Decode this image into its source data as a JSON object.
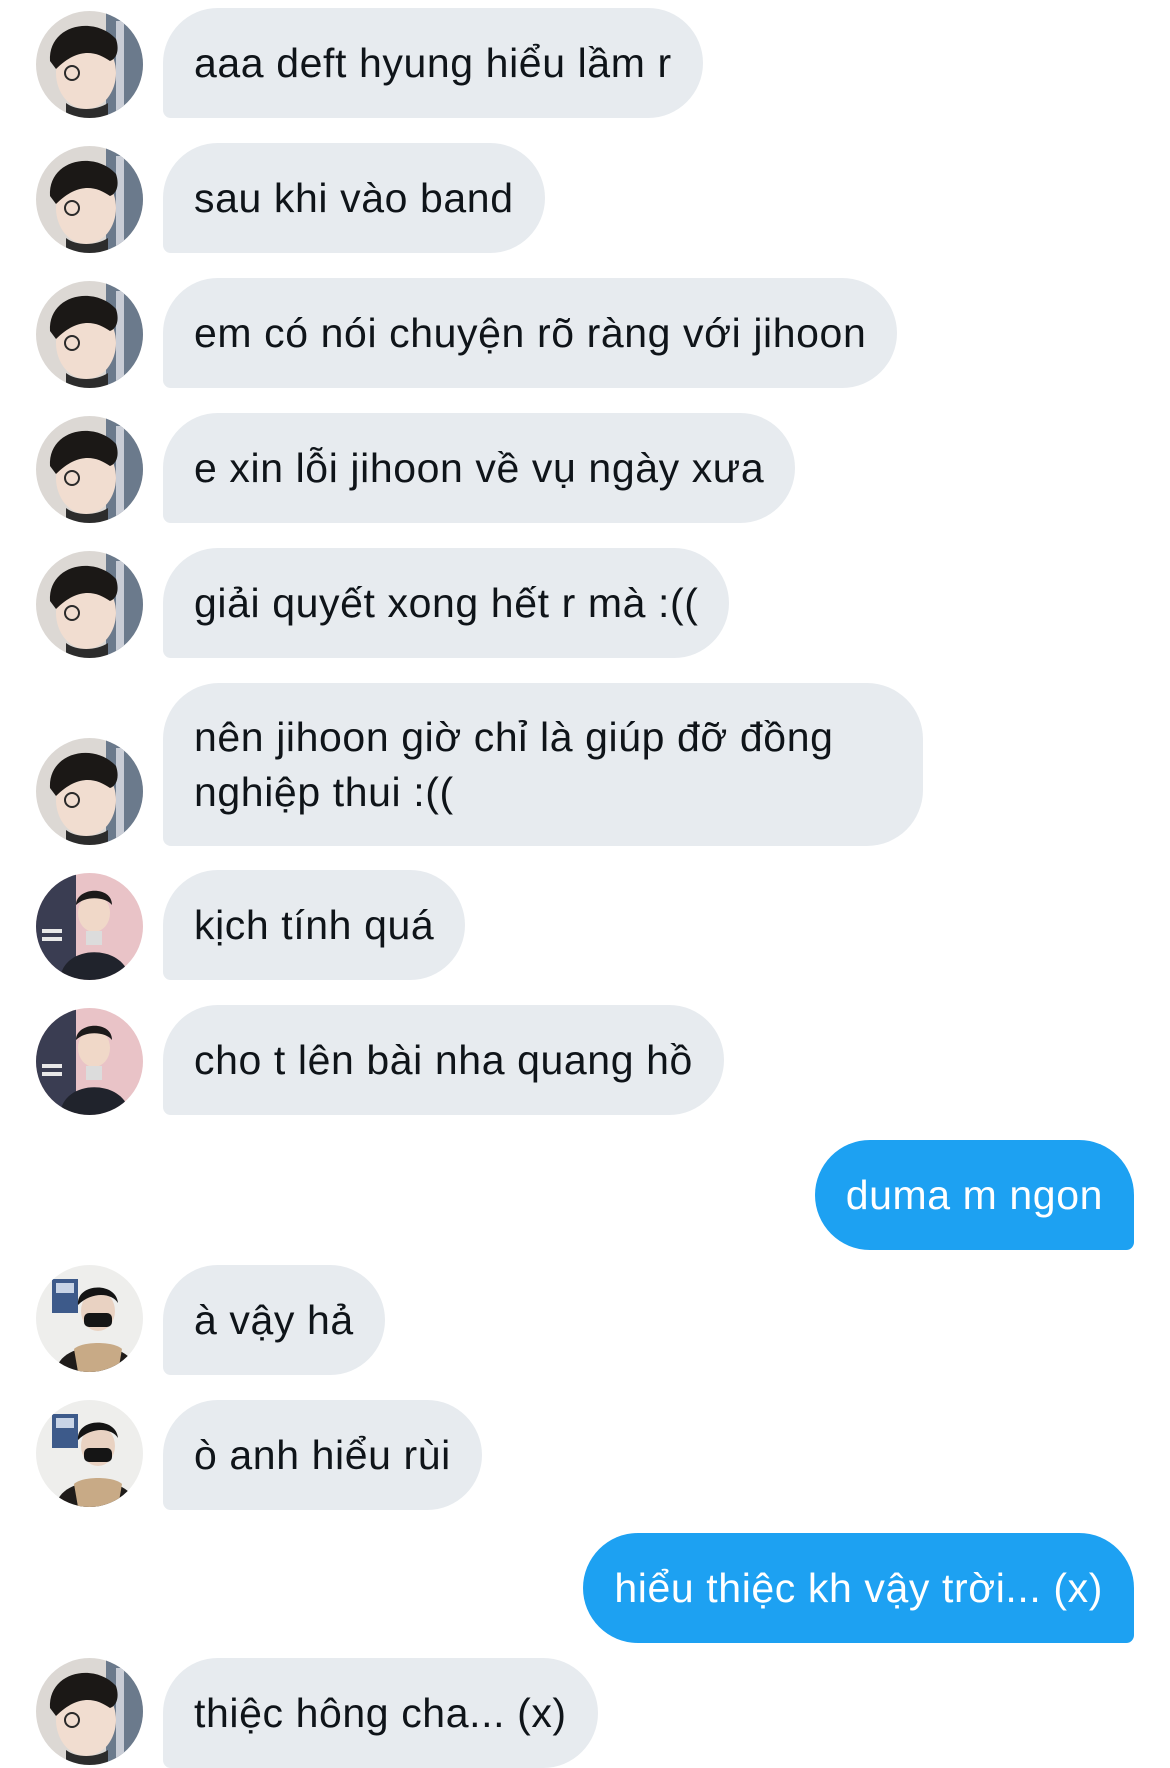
{
  "conversation": {
    "messages": [
      {
        "sender": "contact_a",
        "text": "aaa deft hyung hiểu lầm r"
      },
      {
        "sender": "contact_a",
        "text": "sau khi vào band"
      },
      {
        "sender": "contact_a",
        "text": "em có nói chuyện rõ ràng với jihoon"
      },
      {
        "sender": "contact_a",
        "text": "e xin lỗi jihoon về vụ ngày xưa"
      },
      {
        "sender": "contact_a",
        "text": "giải quyết xong hết r mà :(("
      },
      {
        "sender": "contact_a",
        "text": "nên jihoon giờ chỉ là giúp đỡ đồng nghiệp thui :(("
      },
      {
        "sender": "contact_b",
        "text": "kịch tính quá"
      },
      {
        "sender": "contact_b",
        "text": "cho t lên bài nha quang hồ"
      },
      {
        "sender": "me",
        "text": "duma m ngon"
      },
      {
        "sender": "contact_c",
        "text": "à vậy hả"
      },
      {
        "sender": "contact_c",
        "text": "ò anh hiểu rùi"
      },
      {
        "sender": "me",
        "text": "hiểu thiệc kh vậy trời... (x)"
      },
      {
        "sender": "contact_a",
        "text": "thiệc hông cha... (x)"
      }
    ]
  },
  "colors": {
    "incoming_bubble": "#e7ebef",
    "incoming_text": "#0f1419",
    "outgoing_bubble": "#1da1f2",
    "outgoing_text": "#ffffff",
    "background": "#ffffff"
  },
  "icons": {
    "contact_a": "avatar-photo-glasses-boy",
    "contact_b": "avatar-photo-suit-man",
    "contact_c": "avatar-photo-masked-person"
  }
}
